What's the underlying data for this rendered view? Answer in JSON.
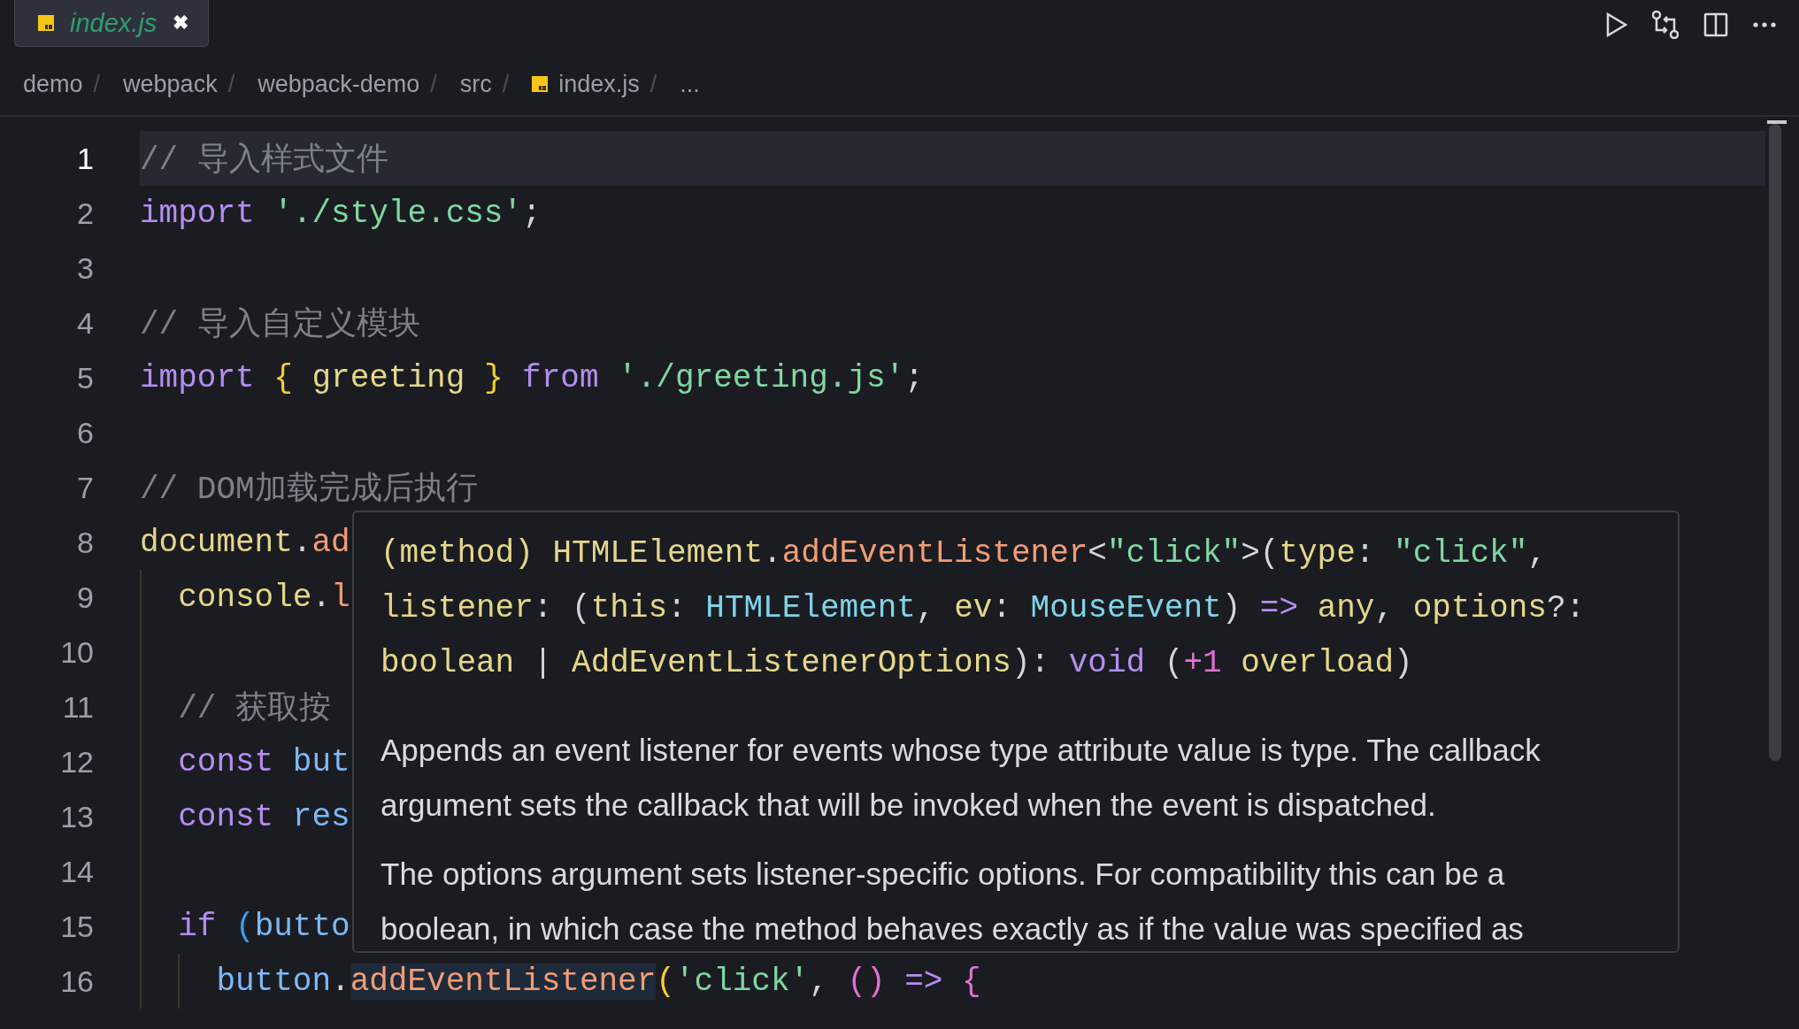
{
  "tabs": [
    {
      "label": "index.js",
      "selected": true,
      "close": "✖"
    }
  ],
  "breadcrumbs": [
    {
      "label": "demo",
      "kind": "folder",
      "separator": "/"
    },
    {
      "label": "webpack",
      "kind": "folder",
      "separator": "/"
    },
    {
      "label": "webpack-demo",
      "kind": "folder",
      "separator": "/"
    },
    {
      "label": "src",
      "kind": "folder",
      "separator": "/"
    },
    {
      "label": "index.js",
      "kind": "file",
      "separator": "/"
    },
    {
      "label": "...",
      "kind": "more"
    }
  ],
  "editor": {
    "lines": [
      {
        "number": "1",
        "current": true,
        "tokens": [
          {
            "kind": "comment",
            "t": "// 导入样式文件"
          }
        ]
      },
      {
        "number": "2",
        "current": false,
        "tokens": [
          {
            "kind": "keyword",
            "t": "import "
          },
          {
            "kind": "string",
            "t": "'./style.css'"
          },
          {
            "kind": "plain",
            "t": ";"
          }
        ]
      },
      {
        "number": "3",
        "current": false
      },
      {
        "number": "4",
        "current": false,
        "tokens": [
          {
            "kind": "comment",
            "t": "// 导入自定义模块"
          }
        ]
      },
      {
        "number": "5",
        "current": false,
        "tokens": [
          {
            "kind": "keyword",
            "t": "import "
          },
          {
            "kind": "brace",
            "t": "{ "
          },
          {
            "kind": "variable",
            "t": "greeting "
          },
          {
            "kind": "brace",
            "t": "} "
          },
          {
            "kind": "keyword",
            "t": "from "
          },
          {
            "kind": "string",
            "t": "'./greeting.js'"
          },
          {
            "kind": "plain",
            "t": ";"
          }
        ]
      },
      {
        "number": "6",
        "current": false
      },
      {
        "number": "7",
        "current": false,
        "tokens": [
          {
            "kind": "comment",
            "t": "// DOM加载完成后执行"
          }
        ]
      },
      {
        "number": "8",
        "current": false,
        "tokens": [
          {
            "kind": "variable",
            "t": "document"
          },
          {
            "kind": "plain",
            "t": "."
          },
          {
            "kind": "method",
            "t": "ad"
          }
        ]
      },
      {
        "number": "9",
        "current": false,
        "tokens": [
          {
            "kind": "variable",
            "t": "  console"
          },
          {
            "kind": "plain",
            "t": "."
          },
          {
            "kind": "method",
            "t": "l"
          }
        ]
      },
      {
        "number": "10",
        "current": false
      },
      {
        "number": "11",
        "current": false,
        "tokens": [
          {
            "kind": "comment",
            "t": "  // 获取按"
          }
        ]
      },
      {
        "number": "12",
        "current": false,
        "tokens": [
          {
            "kind": "keyword",
            "t": "  const "
          },
          {
            "kind": "local",
            "t": "but"
          }
        ]
      },
      {
        "number": "13",
        "current": false,
        "tokens": [
          {
            "kind": "keyword",
            "t": "  const "
          },
          {
            "kind": "local",
            "t": "res"
          }
        ]
      },
      {
        "number": "14",
        "current": false
      },
      {
        "number": "15",
        "current": false,
        "tokens": [
          {
            "kind": "keyword",
            "t": "  if "
          },
          {
            "kind": "paren",
            "t": "("
          },
          {
            "kind": "local",
            "t": "butto"
          }
        ]
      },
      {
        "number": "16",
        "current": false,
        "tokens": [
          {
            "kind": "local",
            "t": "    button"
          },
          {
            "kind": "plain",
            "t": "."
          },
          {
            "kind": "highlight",
            "t": "addEventListener"
          },
          {
            "kind": "brace",
            "t": "("
          },
          {
            "kind": "string",
            "t": "'click'"
          },
          {
            "kind": "plain",
            "t": ", "
          },
          {
            "kind": "pink",
            "t": "()"
          },
          {
            "kind": "keyword",
            "t": " => "
          },
          {
            "kind": "pink",
            "t": "{"
          }
        ]
      }
    ]
  },
  "hover": {
    "signature": [
      [
        {
          "kind": "variable",
          "t": "(method) HTMLElement"
        },
        {
          "kind": "plain",
          "t": "."
        },
        {
          "kind": "method",
          "t": "addEventListener"
        },
        {
          "kind": "plain",
          "t": "<"
        },
        {
          "kind": "string",
          "t": "\"click\""
        },
        {
          "kind": "plain",
          "t": ">("
        },
        {
          "kind": "variable",
          "t": "type"
        },
        {
          "kind": "plain",
          "t": ": "
        },
        {
          "kind": "string",
          "t": "\"click\""
        },
        {
          "kind": "plain",
          "t": ","
        }
      ],
      [
        {
          "kind": "variable",
          "t": "listener"
        },
        {
          "kind": "plain",
          "t": ": ("
        },
        {
          "kind": "variable",
          "t": "this"
        },
        {
          "kind": "plain",
          "t": ": "
        },
        {
          "kind": "type",
          "t": "HTMLElement"
        },
        {
          "kind": "plain",
          "t": ", "
        },
        {
          "kind": "variable",
          "t": "ev"
        },
        {
          "kind": "plain",
          "t": ": "
        },
        {
          "kind": "type",
          "t": "MouseEvent"
        },
        {
          "kind": "plain",
          "t": ") "
        },
        {
          "kind": "keyword",
          "t": "=>"
        },
        {
          "kind": "variable",
          "t": " any"
        },
        {
          "kind": "plain",
          "t": ", "
        },
        {
          "kind": "variable",
          "t": "options"
        },
        {
          "kind": "plain",
          "t": "?:"
        }
      ],
      [
        {
          "kind": "variable",
          "t": "boolean"
        },
        {
          "kind": "plain",
          "t": " | "
        },
        {
          "kind": "variable",
          "t": "AddEventListenerOptions"
        },
        {
          "kind": "plain",
          "t": "): "
        },
        {
          "kind": "keyword",
          "t": "void"
        },
        {
          "kind": "plain",
          "t": " ("
        },
        {
          "kind": "pink",
          "t": "+1"
        },
        {
          "kind": "variable",
          "t": " overload"
        },
        {
          "kind": "plain",
          "t": ")"
        }
      ]
    ],
    "paragraphs": [
      {
        "lines": [
          "Appends an event listener for events whose type attribute value is type. The callback",
          "argument sets the callback that will be invoked when the event is dispatched."
        ]
      },
      {
        "lines": [
          "The options argument sets listener-specific options. For compatibility this can be a",
          "boolean, in which case the method behaves exactly as if the value was specified as"
        ]
      }
    ]
  }
}
